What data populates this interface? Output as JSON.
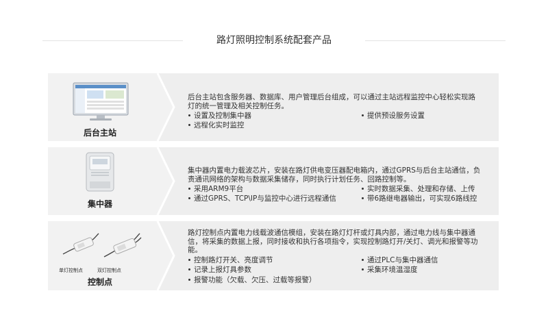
{
  "title": "路灯照明控制系统配套产品",
  "cards": [
    {
      "label": "后台主站",
      "image": "computer-monitor",
      "description": "后台主站包含服务器、数据库、用户管理后台组成，可以通过主站远程监控中心轻松实现路灯的统一管理及相关控制任务。",
      "bullets": [
        "设置及控制集中器",
        "提供预设服务设置",
        "远程化实时监控"
      ]
    },
    {
      "label": "集中器",
      "image": "concentrator-device",
      "description": "集中器内置电力载波芯片，安装在路灯供电变压器配电箱内，通过GPRS与后台主站通信，负责通讯网络的架构与数据采集储存，同时执行计划任务、回路控制等。",
      "bullets": [
        "采用ARM9平台",
        "实时数据采集、处理和存储、上传",
        "通过GPRS、TCP\\IP与监控中心进行远程通信",
        "带6路继电器输出，可实现6路线控"
      ]
    },
    {
      "label": "控制点",
      "image": "lamp-controllers",
      "sublabels": [
        "单灯控制点",
        "双灯控制点"
      ],
      "description": "路灯控制点内置电力线载波通信模组，安装在路灯灯杆或灯具内部，通过电力线与集中器通信，将采集的数据上报，同时接收和执行各项指令，实现控制路灯开/关灯、调光和报警等功能。",
      "bullets": [
        "控制路灯开关、亮度调节",
        "通过PLC与集中器通信",
        "记录上报灯具参数",
        "采集环境温湿度",
        "报警功能（欠载、欠压、过载等报警）"
      ]
    }
  ]
}
